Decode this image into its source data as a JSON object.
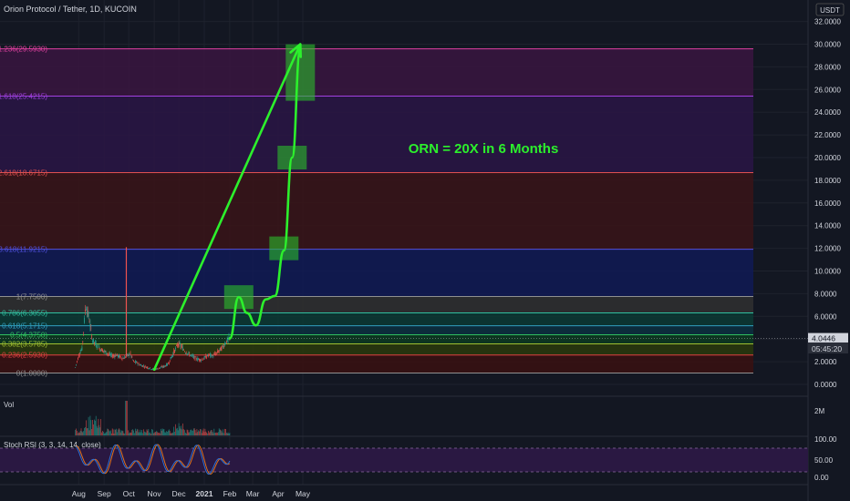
{
  "header": {
    "title": "Orion Protocol / Tether, 1D, KUCOIN",
    "currency": "USDT"
  },
  "price_axis": {
    "ticks": [
      "32.0000",
      "30.0000",
      "28.0000",
      "26.0000",
      "24.0000",
      "22.0000",
      "20.0000",
      "18.0000",
      "16.0000",
      "14.0000",
      "12.0000",
      "10.0000",
      "8.0000",
      "6.0000",
      "4.0000",
      "2.0000",
      "0.0000"
    ],
    "last_price": "4.0446",
    "countdown": "05:45:20"
  },
  "fib_levels": [
    {
      "label": "1.236(29.5930)",
      "value": 29.593,
      "color": "#e040a0",
      "fill": "#3a1540"
    },
    {
      "label": "1.618(25.4215)",
      "value": 25.4215,
      "color": "#a040e0",
      "fill": "#2a1545"
    },
    {
      "label": "2.618(18.6715)",
      "value": 18.6715,
      "color": "#e05050",
      "fill": "#3a1418"
    },
    {
      "label": "3.618(11.9215)",
      "value": 11.9215,
      "color": "#5050e0",
      "fill": "#101a55"
    },
    {
      "label": "1(7.7500)",
      "value": 7.75,
      "color": "#909090",
      "fill": "#303030"
    },
    {
      "label": "0.786(6.3055)",
      "value": 6.3055,
      "color": "#30c0a0",
      "fill": "#0c3a34"
    },
    {
      "label": "0.618(5.1715)",
      "value": 5.1715,
      "color": "#30a0c0",
      "fill": "#0c3040"
    },
    {
      "label": "0.5(4.3750)",
      "value": 4.375,
      "color": "#30c060",
      "fill": "#0c3a20"
    },
    {
      "label": "0.382(3.5785)",
      "value": 3.5785,
      "color": "#a0c030",
      "fill": "#2a3a0c"
    },
    {
      "label": "0.236(2.5930)",
      "value": 2.593,
      "color": "#e04040",
      "fill": "#3a1010"
    },
    {
      "label": "0(1.0000)",
      "value": 1.0,
      "color": "#909090",
      "fill": ""
    }
  ],
  "annotation": {
    "text": "ORN = 20X in 6 Months",
    "color": "#2cf02c"
  },
  "volume": {
    "label": "Vol",
    "tick": "2M"
  },
  "stoch": {
    "label": "Stoch RSI (3, 3, 14, 14, close)",
    "ticks": [
      "100.00",
      "50.00",
      "0.00"
    ],
    "k_color": "#2a6fd6",
    "d_color": "#e0701a"
  },
  "time_axis": {
    "labels": [
      "Aug",
      "Sep",
      "Oct",
      "Nov",
      "Dec",
      "2021",
      "Feb",
      "Mar",
      "Apr",
      "May"
    ],
    "bold_label": "2021"
  },
  "chart_data": {
    "type": "line",
    "title": "Orion Protocol / Tether, 1D, KUCOIN",
    "xlabel": "",
    "ylabel": "USDT",
    "ylim": [
      0,
      32
    ],
    "grid": true,
    "series": [
      {
        "values": [
          1.5,
          2.6,
          3.2,
          7.0,
          5.8,
          3.9,
          3.5,
          3.2,
          3.0,
          2.8,
          2.6,
          2.5,
          2.6,
          2.4,
          2.3,
          2.5,
          2.7,
          2.0,
          1.9,
          1.7,
          1.6,
          1.5,
          1.4,
          1.3,
          1.4,
          1.5,
          1.6,
          1.8,
          2.4,
          3.0,
          3.6,
          3.3,
          2.9,
          2.7,
          2.5,
          2.3,
          2.2,
          2.2,
          2.4,
          2.6,
          2.5,
          2.7,
          3.0,
          3.3,
          3.8,
          4.05
        ]
      },
      {
        "x": [
          "2021-02-01",
          "2021-02-12",
          "2021-02-22",
          "2021-03-05",
          "2021-03-17",
          "2021-03-28",
          "2021-04-08",
          "2021-04-18",
          "2021-04-28"
        ],
        "values": [
          4.05,
          7.7,
          6.3,
          5.2,
          7.5,
          7.8,
          11.8,
          20.0,
          29.6
        ]
      }
    ],
    "trend_arrow": {
      "from": {
        "x": "2020-11-01",
        "y": 1.3
      },
      "to": {
        "x": "2021-04-28",
        "y": 30.0
      }
    },
    "volume_spike": "2020-09-28",
    "target_zones": [
      {
        "x": "2021-02-12",
        "y": 7.7
      },
      {
        "x": "2021-04-08",
        "y": 12.0
      },
      {
        "x": "2021-04-18",
        "y": 20.0
      },
      {
        "x": "2021-04-28",
        "y": 27.5
      }
    ]
  }
}
